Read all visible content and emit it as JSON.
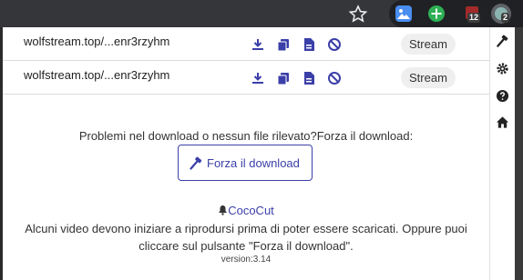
{
  "browser": {
    "extensions": [
      {
        "icon": "photos-extension-icon"
      },
      {
        "icon": "plus-extension-icon"
      },
      {
        "icon": "red-extension-icon",
        "badge": "12"
      },
      {
        "icon": "cococut-extension-icon",
        "badge": "2"
      }
    ]
  },
  "downloads": [
    {
      "url": "wolfstream.top/...enr3rzyhm",
      "action_label": "Stream"
    },
    {
      "url": "wolfstream.top/...enr3rzyhm",
      "action_label": "Stream"
    }
  ],
  "force": {
    "problem_text": "Problemi nel download o nessun file rilevato?Forza il download:",
    "button_label": "Forza il download"
  },
  "footer": {
    "brand": "CocoCut",
    "description_line1": "Alcuni video devono iniziare a riprodursi prima di poter essere scaricati. Oppure puoi",
    "description_line2": "cliccare sul pulsante \"Forza il download\".",
    "version": "version:3.14"
  },
  "colors": {
    "accent": "#3b3fa8",
    "background": "#ffffff",
    "toolbar": "#35363a"
  }
}
